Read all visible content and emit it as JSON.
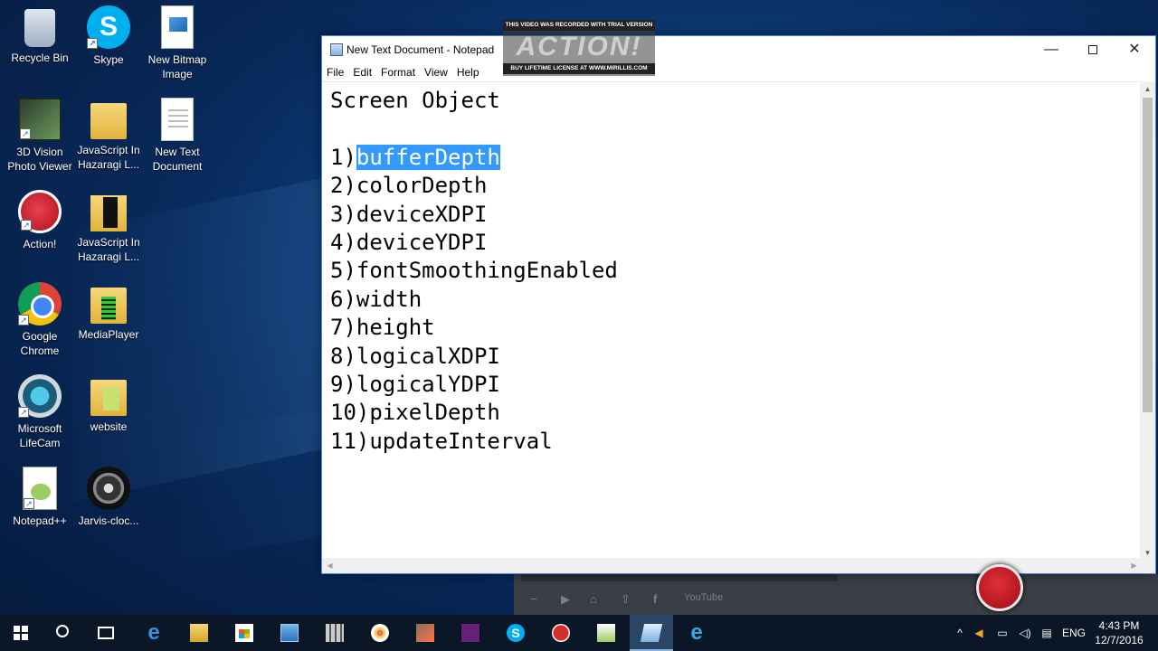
{
  "desktop": {
    "icons": [
      {
        "label": "Recycle Bin"
      },
      {
        "label": "Skype"
      },
      {
        "label": "New Bitmap Image"
      },
      {
        "label": "3D Vision Photo Viewer"
      },
      {
        "label": "JavaScript In Hazaragi L..."
      },
      {
        "label": "New Text Document"
      },
      {
        "label": "Action!"
      },
      {
        "label": "JavaScript In Hazaragi L..."
      },
      {
        "label": "Google Chrome"
      },
      {
        "label": "MediaPlayer"
      },
      {
        "label": "Microsoft LifeCam"
      },
      {
        "label": "website"
      },
      {
        "label": "Notepad++"
      },
      {
        "label": "Jarvis-cloc..."
      }
    ]
  },
  "watermark": {
    "top": "THIS VIDEO WAS RECORDED WITH TRIAL VERSION",
    "logo": "ACTION!",
    "bottom": "BUY LIFETIME LICENSE AT WWW.MIRILLIS.COM"
  },
  "notepad": {
    "title": "New Text Document - Notepad",
    "menu": [
      "File",
      "Edit",
      "Format",
      "View",
      "Help"
    ],
    "lines": [
      {
        "prefix": "Screen Object",
        "selected": ""
      },
      {
        "prefix": "",
        "selected": ""
      },
      {
        "prefix": "1)",
        "selected": "bufferDepth"
      },
      {
        "prefix": "2)colorDepth",
        "selected": ""
      },
      {
        "prefix": "3)deviceXDPI",
        "selected": ""
      },
      {
        "prefix": "4)deviceYDPI",
        "selected": ""
      },
      {
        "prefix": "5)fontSmoothingEnabled",
        "selected": ""
      },
      {
        "prefix": "6)width",
        "selected": ""
      },
      {
        "prefix": "7)height",
        "selected": ""
      },
      {
        "prefix": "8)logicalXDPI",
        "selected": ""
      },
      {
        "prefix": "9)logicalYDPI",
        "selected": ""
      },
      {
        "prefix": "10)pixelDepth",
        "selected": ""
      },
      {
        "prefix": "11)updateInterval",
        "selected": ""
      }
    ]
  },
  "recorder": {
    "youtube_label": "YouTube"
  },
  "taskbar": {
    "language": "ENG",
    "time": "4:43 PM",
    "date": "12/7/2016"
  },
  "colors": {
    "selection": "#3399ff",
    "taskbar": "#0b1727",
    "accent": "#4a8ad6"
  }
}
